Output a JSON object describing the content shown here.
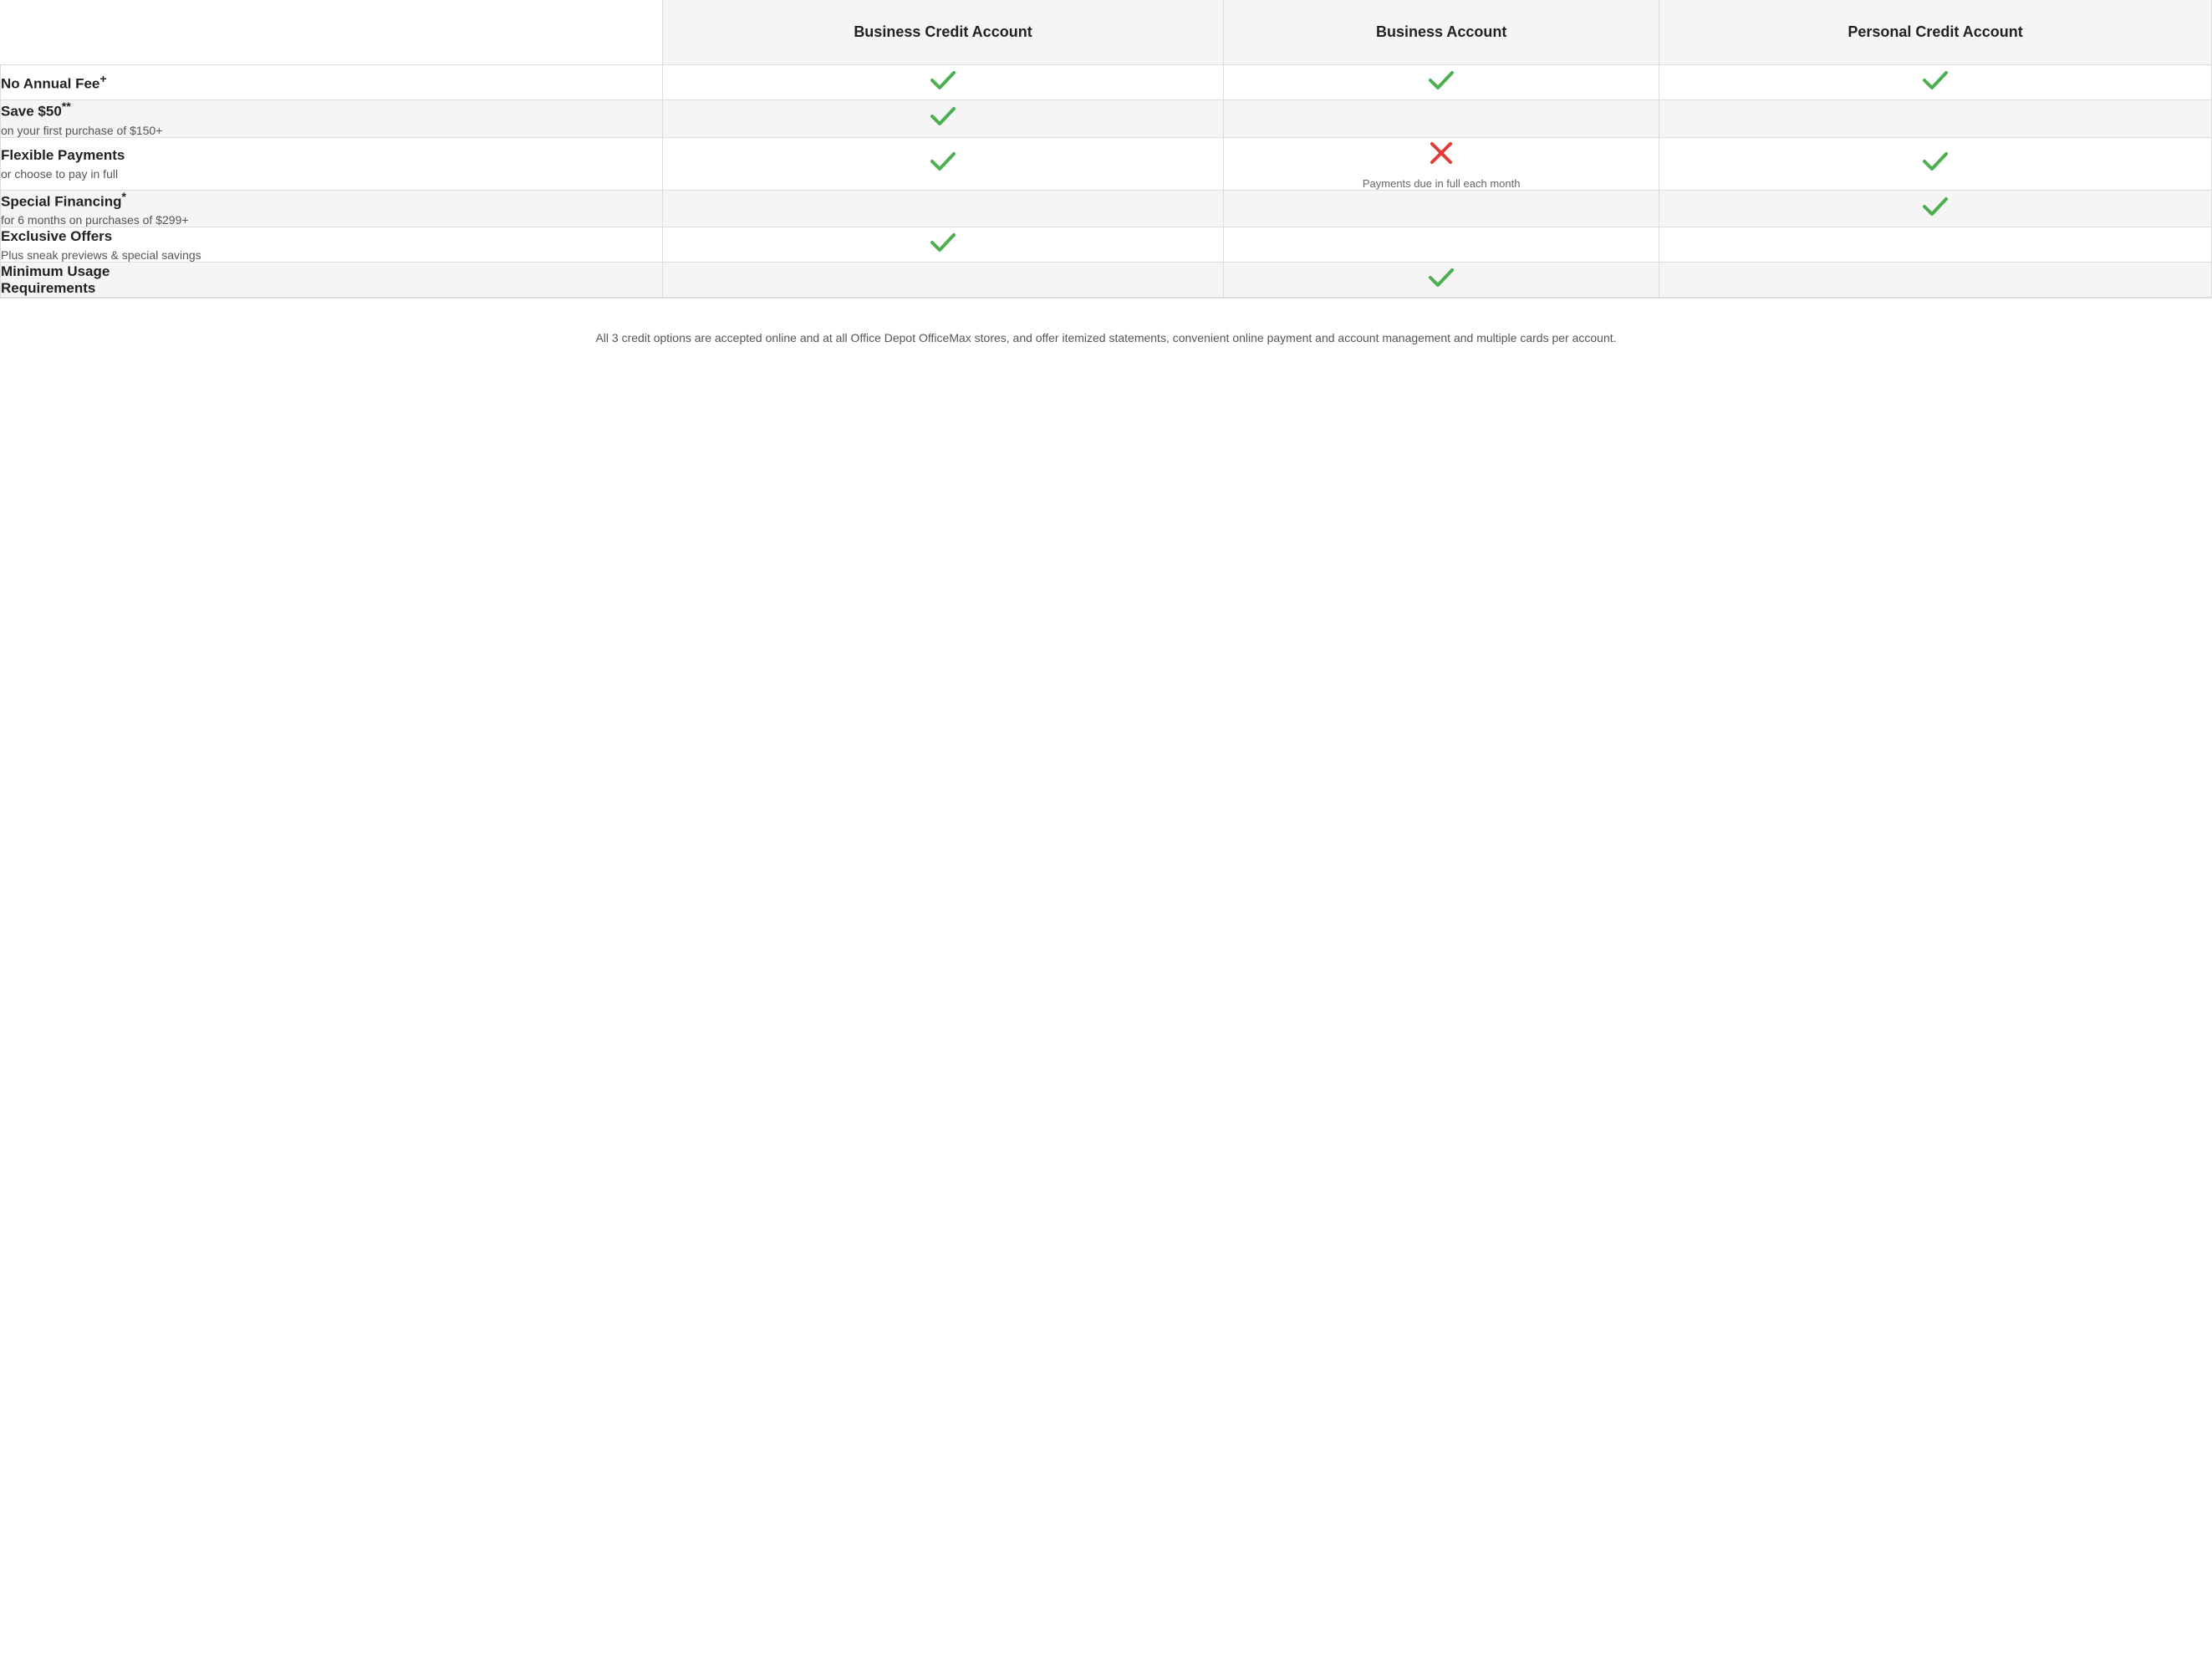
{
  "header": {
    "col1_label": "",
    "col2_label": "Business Credit Account",
    "col3_label": "Business Account",
    "col4_label": "Personal Credit Account"
  },
  "rows": [
    {
      "id": "no-annual-fee",
      "title": "No Annual Fee",
      "title_suffix": "+",
      "subtitle": "",
      "col2": "check",
      "col3": "check",
      "col4": "check",
      "col3_note": ""
    },
    {
      "id": "save-50",
      "title": "Save $50",
      "title_suffix": "**",
      "subtitle": "on your first purchase of $150+",
      "col2": "check",
      "col3": "empty",
      "col4": "empty",
      "col3_note": ""
    },
    {
      "id": "flexible-payments",
      "title": "Flexible Payments",
      "title_suffix": "",
      "subtitle": "or choose to pay in full",
      "col2": "check",
      "col3": "cross",
      "col4": "check",
      "col3_note": "Payments due in full each month"
    },
    {
      "id": "special-financing",
      "title": "Special Financing",
      "title_suffix": "*",
      "subtitle": "for 6 months on purchases of $299+",
      "col2": "empty",
      "col3": "empty",
      "col4": "check",
      "col3_note": ""
    },
    {
      "id": "exclusive-offers",
      "title": "Exclusive Offers",
      "title_suffix": "",
      "subtitle": "Plus sneak previews & special savings",
      "col2": "check",
      "col3": "empty",
      "col4": "empty",
      "col3_note": ""
    },
    {
      "id": "minimum-usage",
      "title": "Minimum Usage",
      "title_suffix": "",
      "title_line2": "Requirements",
      "subtitle": "",
      "col2": "empty",
      "col3": "check",
      "col4": "empty",
      "col3_note": ""
    }
  ],
  "footer": {
    "text": "All 3 credit options are accepted online and at all Office Depot OfficeMax stores, and offer itemized statements, convenient online payment and account management and multiple cards per account."
  }
}
